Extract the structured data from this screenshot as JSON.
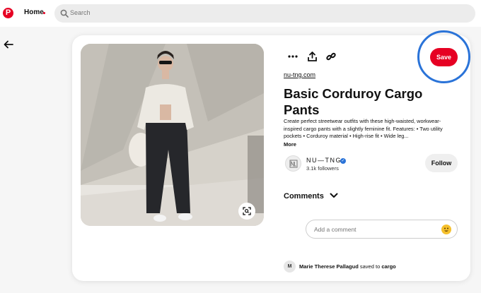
{
  "header": {
    "home_label": "Home",
    "search_placeholder": "Search",
    "accent_color": "#e60023"
  },
  "pin": {
    "save_label": "Save",
    "domain": "nu-tng.com",
    "title": "Basic Corduroy Cargo Pants",
    "description": "Create perfect streetwear outfits with these high-waisted, workwear-inspired cargo pants with a slightly feminine fit. Features: • Two utility pockets • Corduroy material • High-rise fit • Wide leg...",
    "more_label": "More",
    "actions": [
      "more-options-icon",
      "share-icon",
      "link-icon"
    ]
  },
  "creator": {
    "name": "NU—TNG",
    "followers": "3.1k followers",
    "follow_label": "Follow",
    "verified_color": "#2a73d8"
  },
  "comments": {
    "heading": "Comments",
    "placeholder": "Add a comment"
  },
  "activity": {
    "avatar_initial": "M",
    "user": "Marie Therese Pallagud",
    "verb": "saved to",
    "board": "cargo"
  },
  "highlight_color": "#2a73d8"
}
